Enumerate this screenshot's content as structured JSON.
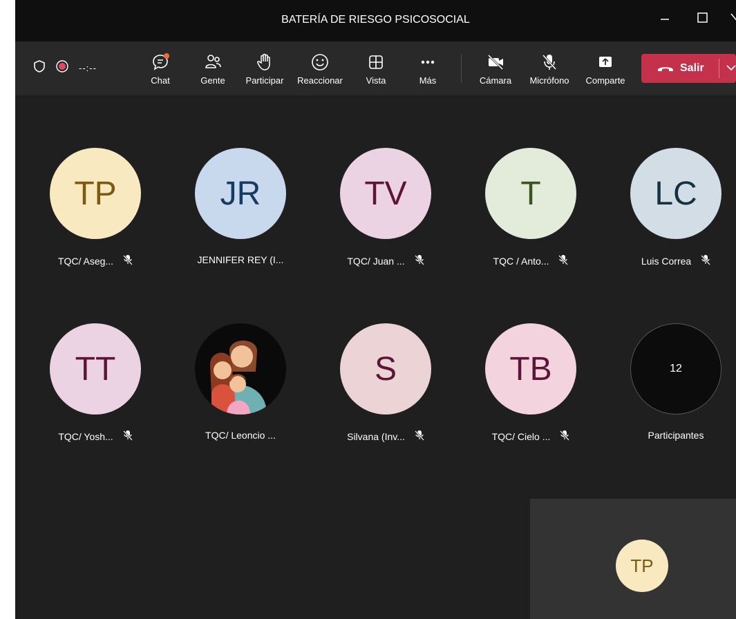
{
  "window": {
    "title": "BATERÍA DE RIESGO PSICOSOCIAL",
    "controls": [
      "minimize-icon",
      "maximize-icon",
      "close-icon"
    ]
  },
  "toolbar": {
    "recording_time": "--:--",
    "items": [
      {
        "label": "Chat",
        "icon": "chat-icon",
        "badge": true
      },
      {
        "label": "Gente",
        "icon": "people-icon"
      },
      {
        "label": "Participar",
        "icon": "raise-hand-icon"
      },
      {
        "label": "Reaccionar",
        "icon": "smile-icon"
      },
      {
        "label": "Vista",
        "icon": "grid-view-icon"
      },
      {
        "label": "Más",
        "icon": "more-icon"
      },
      {
        "label": "Cámara",
        "icon": "camera-off-icon"
      },
      {
        "label": "Micrófono",
        "icon": "mic-off-icon"
      },
      {
        "label": "Comparte",
        "icon": "share-icon"
      }
    ],
    "leave_label": "Salir"
  },
  "participants": [
    {
      "initials": "TP",
      "name": "TQC/ Aseg...",
      "muted": true,
      "bg": "#f8e9c0",
      "fg": "#7b5a12"
    },
    {
      "initials": "JR",
      "name": "JENNIFER REY (I...",
      "muted": false,
      "bg": "#c8d9ee",
      "fg": "#173a63"
    },
    {
      "initials": "TV",
      "name": "TQC/ Juan ...",
      "muted": true,
      "bg": "#ecd3e3",
      "fg": "#5c1537"
    },
    {
      "initials": "T",
      "name": "TQC / Anto...",
      "muted": true,
      "bg": "#e3ecda",
      "fg": "#3a5323"
    },
    {
      "initials": "LC",
      "name": "Luis Correa",
      "muted": true,
      "bg": "#d3dde5",
      "fg": "#15303f"
    },
    {
      "initials": "TT",
      "name": "TQC/ Yosh...",
      "muted": true,
      "bg": "#ecd3e3",
      "fg": "#5c1537"
    },
    {
      "initials": "",
      "name": "TQC/ Leoncio ...",
      "muted": false,
      "photo": true
    },
    {
      "initials": "S",
      "name": "Silvana (Inv...",
      "muted": true,
      "bg": "#ecd3d6",
      "fg": "#5c1537"
    },
    {
      "initials": "TB",
      "name": "TQC/ Cielo ...",
      "muted": true,
      "bg": "#f2d3de",
      "fg": "#5c1537"
    },
    {
      "initials": "12",
      "name": "Participantes",
      "muted": false,
      "overflow": true
    }
  ],
  "self_view": {
    "initials": "TP"
  },
  "colors": {
    "leave": "#c4314b",
    "badge": "#f06a3a",
    "record": "#e04a5f"
  }
}
